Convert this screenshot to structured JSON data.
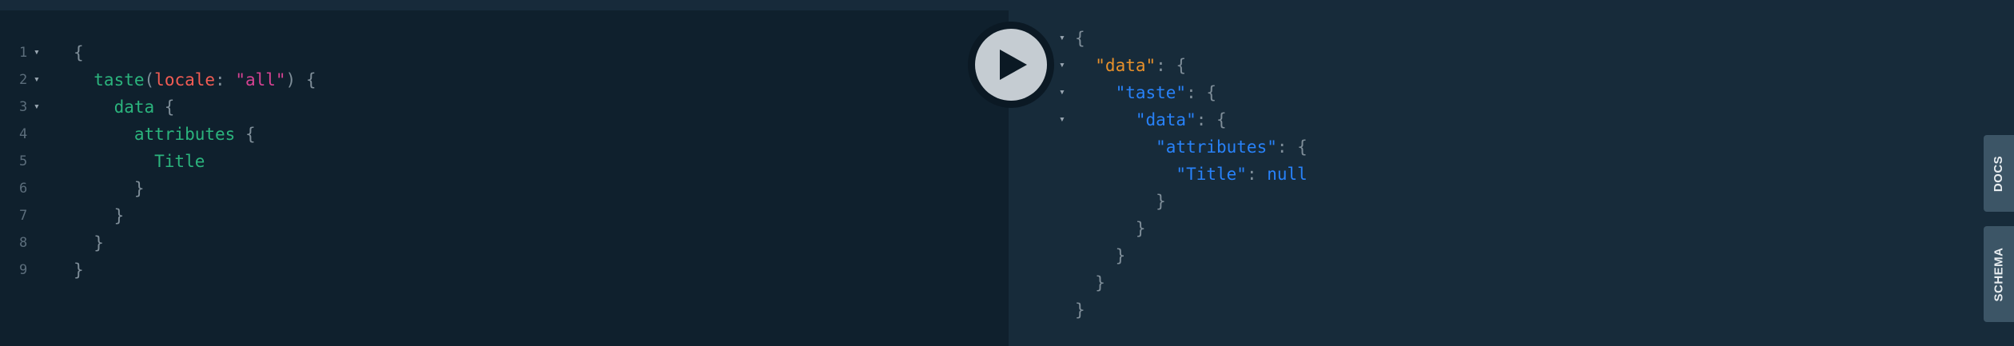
{
  "editor": {
    "line_numbers": [
      "1",
      "2",
      "3",
      "4",
      "5",
      "6",
      "7",
      "8",
      "9"
    ],
    "fold_marker": "▾",
    "lines": [
      [
        {
          "t": "{",
          "c": "punc"
        }
      ],
      [
        {
          "t": "  taste",
          "c": "fn"
        },
        {
          "t": "(",
          "c": "punc"
        },
        {
          "t": "locale",
          "c": "arg"
        },
        {
          "t": ": ",
          "c": "punc"
        },
        {
          "t": "\"all\"",
          "c": "str"
        },
        {
          "t": ") {",
          "c": "punc"
        }
      ],
      [
        {
          "t": "    data",
          "c": "fn"
        },
        {
          "t": " {",
          "c": "punc"
        }
      ],
      [
        {
          "t": "      attributes",
          "c": "fn"
        },
        {
          "t": " {",
          "c": "punc"
        }
      ],
      [
        {
          "t": "        Title",
          "c": "fn"
        }
      ],
      [
        {
          "t": "      }",
          "c": "punc"
        }
      ],
      [
        {
          "t": "    }",
          "c": "punc"
        }
      ],
      [
        {
          "t": "  }",
          "c": "punc"
        }
      ],
      [
        {
          "t": "}",
          "c": "punc"
        }
      ]
    ]
  },
  "run_button": {
    "label": "Execute Query",
    "icon": "play-icon"
  },
  "result": {
    "fold_marker": "▾",
    "lines": [
      [
        {
          "t": "{",
          "c": "punc"
        }
      ],
      [
        {
          "t": "  \"data\"",
          "c": "okey"
        },
        {
          "t": ": {",
          "c": "punc"
        }
      ],
      [
        {
          "t": "    \"taste\"",
          "c": "key"
        },
        {
          "t": ": {",
          "c": "punc"
        }
      ],
      [
        {
          "t": "      \"data\"",
          "c": "key"
        },
        {
          "t": ": {",
          "c": "punc"
        }
      ],
      [
        {
          "t": "        \"attributes\"",
          "c": "key"
        },
        {
          "t": ": {",
          "c": "punc"
        }
      ],
      [
        {
          "t": "          \"Title\"",
          "c": "key"
        },
        {
          "t": ": ",
          "c": "punc"
        },
        {
          "t": "null",
          "c": "nul"
        }
      ],
      [
        {
          "t": "        }",
          "c": "punc"
        }
      ],
      [
        {
          "t": "      }",
          "c": "punc"
        }
      ],
      [
        {
          "t": "    }",
          "c": "punc"
        }
      ],
      [
        {
          "t": "  }",
          "c": "punc"
        }
      ],
      [
        {
          "t": "}",
          "c": "punc"
        }
      ]
    ]
  },
  "side_tabs": {
    "docs": "DOCS",
    "schema": "SCHEMA"
  }
}
